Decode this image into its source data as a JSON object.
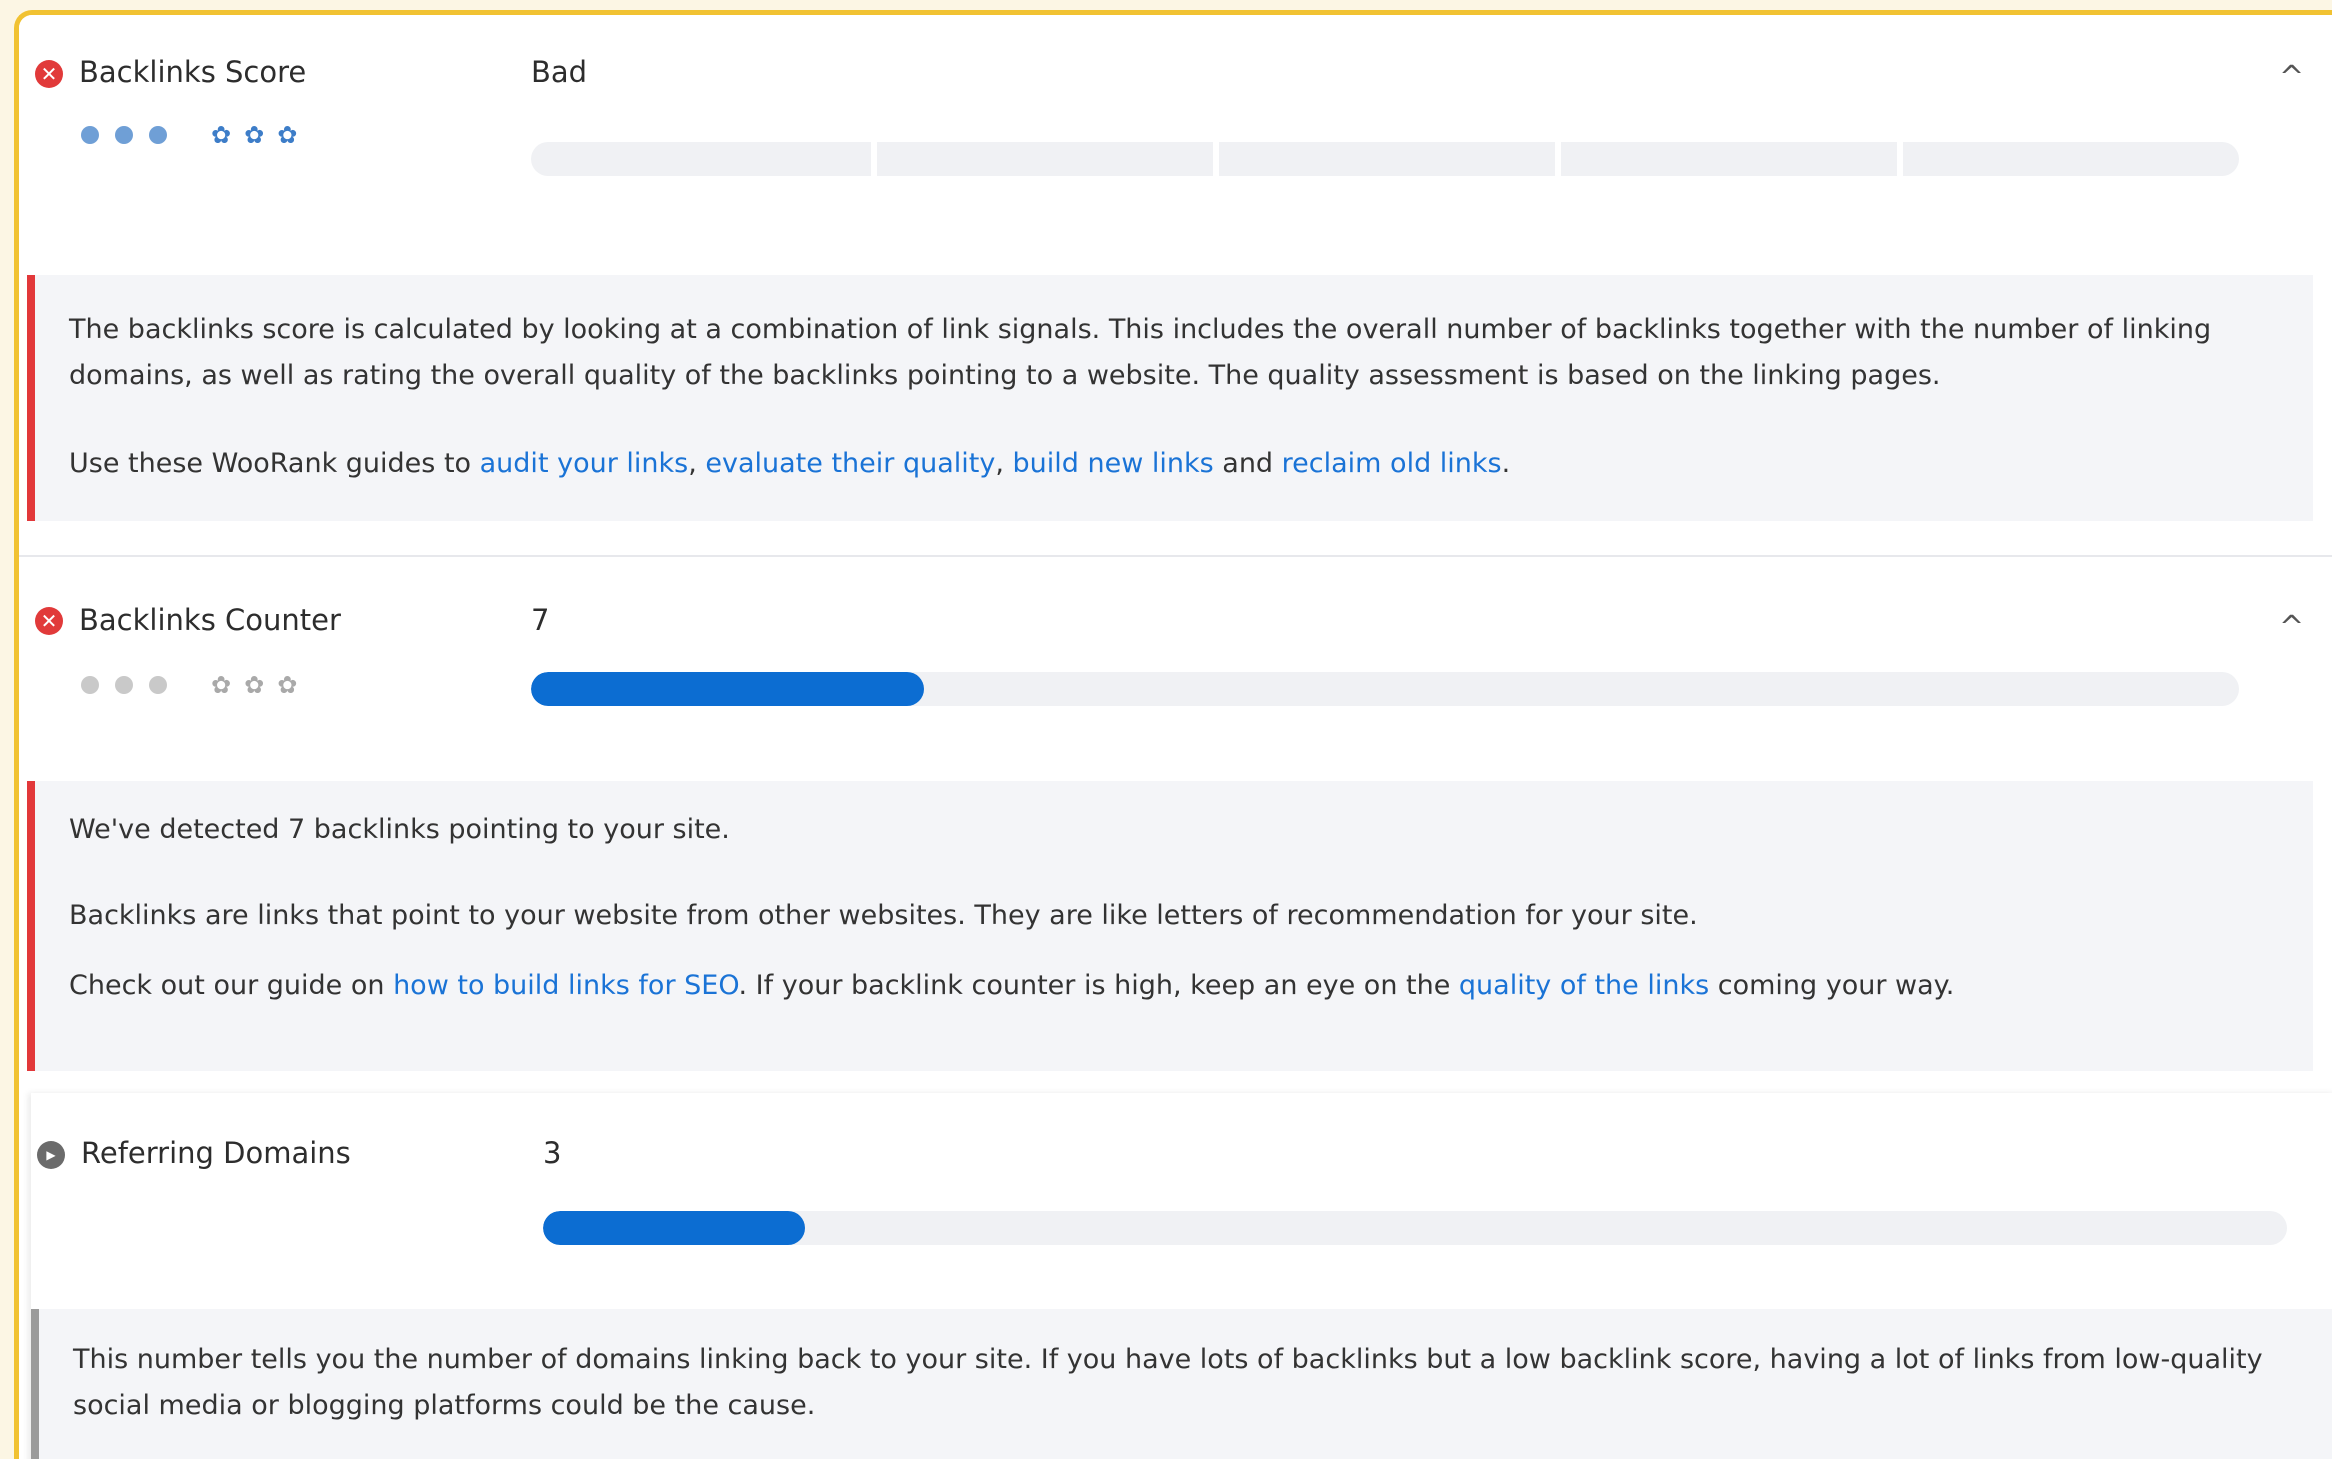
{
  "sections": [
    {
      "title": "Backlinks Score",
      "value": "Bad",
      "status": "bad",
      "fill_percent": 0,
      "description": [
        "The backlinks score is calculated by looking at a combination of link signals. This includes the overall number of backlinks together with the number of linking domains, as well as rating the overall quality of the backlinks pointing to a website. The quality assessment is based on the linking pages."
      ],
      "guides": {
        "intro": "Use these WooRank guides to ",
        "link1": "audit your links",
        "sep1": ", ",
        "link2": "evaluate their quality",
        "sep2": ", ",
        "link3": "build new links",
        "sep3": " and ",
        "link4": "reclaim old links",
        "end": "."
      }
    },
    {
      "title": "Backlinks Counter",
      "value": "7",
      "status": "bad",
      "fill_percent": 23,
      "description": [
        "We've detected 7 backlinks pointing to your site.",
        "Backlinks are links that point to your website from other websites. They are like letters of recommendation for your site."
      ],
      "guide": {
        "intro": "Check out our guide on ",
        "link1": "how to build links for SEO",
        "mid": ". If your backlink counter is high, keep an eye on the ",
        "link2": "quality of the links",
        "end": " coming your way."
      }
    },
    {
      "title": "Referring Domains",
      "value": "3",
      "status": "neutral",
      "fill_percent": 15,
      "description": [
        "This number tells you the number of domains linking back to your site. If you have lots of backlinks but a low backlink score, having a lot of links from low-quality social media or blogging platforms could be the cause."
      ]
    }
  ],
  "icons": {
    "status_bad": "x-circle-icon",
    "status_neutral": "play-circle-icon",
    "collapse": "chevron-up-icon",
    "importance": "dot-icon",
    "difficulty": "gear-icon",
    "glyph_bad": "✕",
    "glyph_neutral": "▶",
    "glyph_chevron": "^",
    "glyph_gear": "✿"
  },
  "colors": {
    "accent_blue": "#0c6dd2",
    "link_blue": "#1a73d6",
    "bad_red": "#e13a3a",
    "frame_yellow": "#f1c232",
    "pip_active": "#6f9fd6",
    "pip_inactive": "#c9c9c9"
  }
}
